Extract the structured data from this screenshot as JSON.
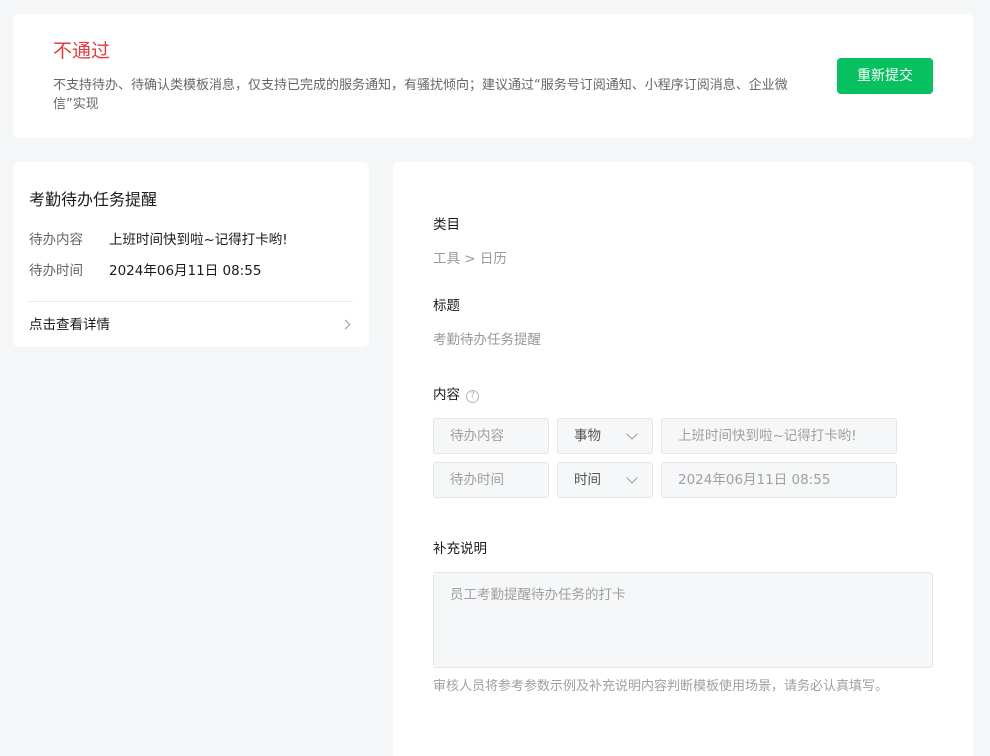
{
  "status": {
    "title": "不通过",
    "reason": "不支持待办、待确认类模板消息，仅支持已完成的服务通知，有骚扰倾向；建议通过“服务号订阅通知、小程序订阅消息、企业微信”实现",
    "resubmit_label": "重新提交",
    "colors": {
      "error": "#e23d3d",
      "primary": "#07c160"
    }
  },
  "preview": {
    "title": "考勤待办任务提醒",
    "rows": [
      {
        "key": "待办内容",
        "value": "上班时间快到啦~记得打卡哟!"
      },
      {
        "key": "待办时间",
        "value": "2024年06月11日 08:55"
      }
    ],
    "detail_link": "点击查看详情"
  },
  "detail": {
    "category_label": "类目",
    "category_value": "工具 > 日历",
    "title_label": "标题",
    "title_value": "考勤待办任务提醒",
    "content_label": "内容",
    "content_help_icon": "question-circle-icon",
    "fields": [
      {
        "name": "待办内容",
        "type": "事物",
        "example": "上班时间快到啦~记得打卡哟!"
      },
      {
        "name": "待办时间",
        "type": "时间",
        "example": "2024年06月11日 08:55"
      }
    ],
    "supplement_label": "补充说明",
    "supplement_value": "员工考勤提醒待办任务的打卡",
    "hint": "审核人员将参考参数示例及补充说明内容判断模板使用场景，请务必认真填写。"
  }
}
